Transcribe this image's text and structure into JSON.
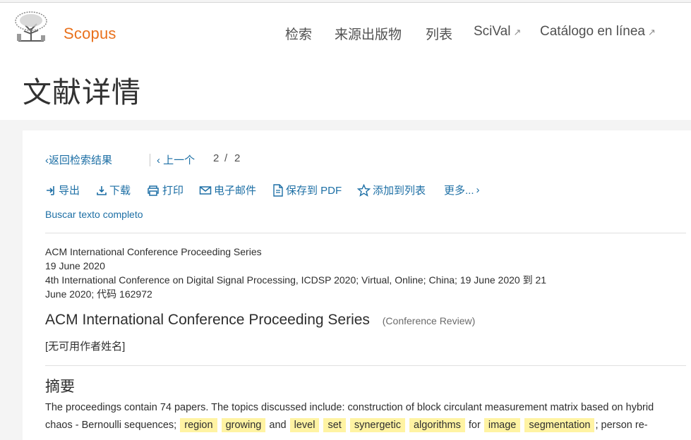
{
  "header": {
    "brand": "Scopus",
    "nav": [
      "检索",
      "来源出版物",
      "列表",
      "SciVal",
      "Catálogo en línea"
    ],
    "ext_icon": "↗",
    "page_title": "文献详情"
  },
  "crumbs": {
    "back": "返回检索结果",
    "prev": "上一个",
    "current": "2",
    "slash": "/",
    "total": "2"
  },
  "toolbar": {
    "export": "导出",
    "download": "下载",
    "print": "打印",
    "email": "电子邮件",
    "save_pdf": "保存到 PDF",
    "add_list": "添加到列表",
    "more": "更多..."
  },
  "fulltext_link": "Buscar texto completo",
  "meta": {
    "series": "ACM International Conference Proceeding Series",
    "date": "19 June 2020",
    "conference_line1": "4th International Conference on Digital Signal Processing, ICDSP 2020; Virtual, Online; China; 19 June 2020 到 21",
    "conference_line2": "June 2020; 代码 162972"
  },
  "doc": {
    "title": "ACM International Conference Proceeding Series",
    "type": "(Conference Review)",
    "authors": "[无可用作者姓名]"
  },
  "abstract": {
    "heading": "摘要",
    "line1": "The proceedings contain 74 papers. The topics discussed include: construction of block circulant measurement matrix based on hybrid",
    "line2_pre": "chaos - Bernoulli sequences;",
    "hl1": [
      "region",
      "growing"
    ],
    "and": "and",
    "hl2": [
      "level",
      "set",
      "synergetic",
      "algorithms"
    ],
    "for": "for",
    "hl3": [
      "image",
      "segmentation"
    ],
    "line2_post": "; person re-"
  },
  "colors": {
    "accent_orange": "#e9711c",
    "link_blue": "#1d6fa5",
    "highlight": "#fff3a3"
  }
}
